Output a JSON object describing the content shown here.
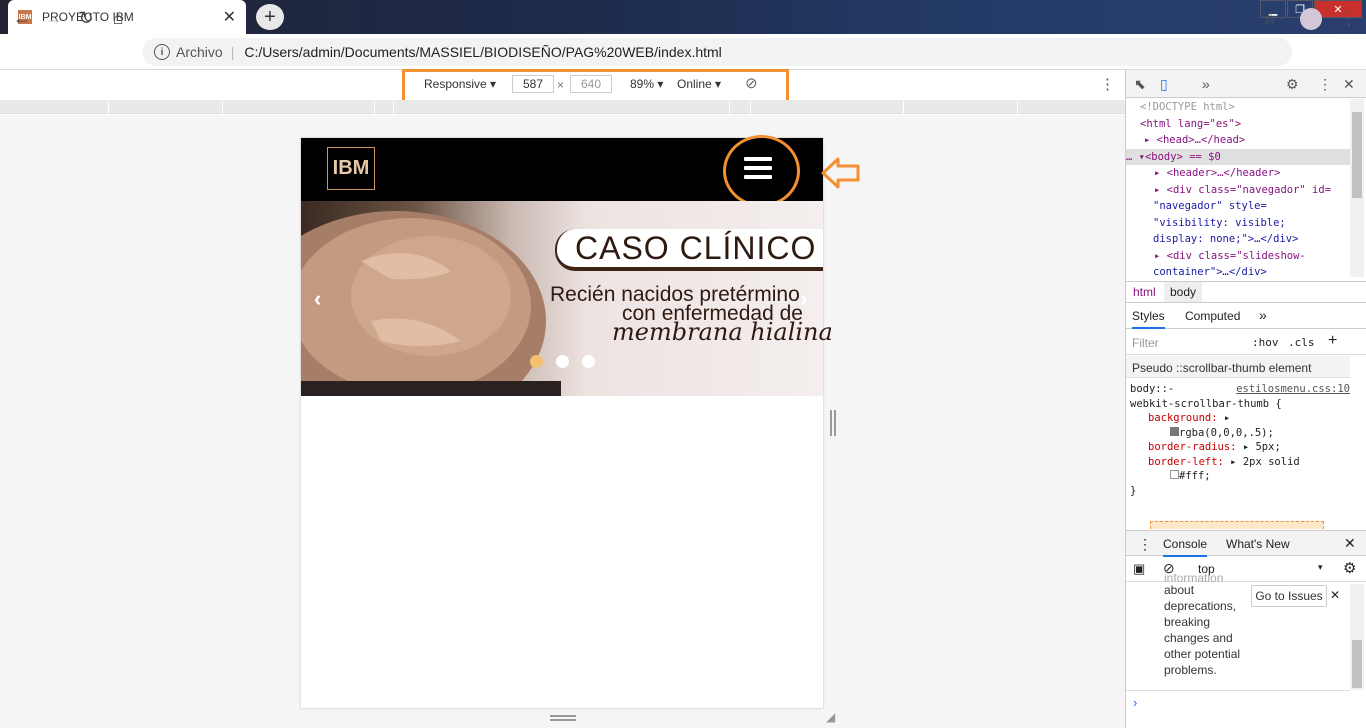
{
  "browser": {
    "tab_title": "PROYECTO IBM",
    "tab_favicon": "IBM",
    "tab_close": "✕",
    "new_tab": "+",
    "site_label": "Archivo",
    "url": "C:/Users/admin/Documents/MASSIEL/BIODISEÑO/PAG%20WEB/index.html"
  },
  "device_toolbar": {
    "mode": "Responsive",
    "width": "587",
    "height": "640",
    "zoom": "89%",
    "network": "Online",
    "times": "×"
  },
  "site": {
    "logo": "IBM",
    "slide_title": "CASO CLÍNICO",
    "slide_line1": "Recién nacidos pretérmino",
    "slide_line2": "con enfermedad de",
    "slide_line3": "membrana hialina",
    "prev": "‹",
    "next": "›",
    "dots_active_color": "#f5c071",
    "dots_color": "#ffffff"
  },
  "devtools": {
    "dom": {
      "doctype": "<!DOCTYPE html>",
      "html_open": "<html lang=\"es\">",
      "head": "<head>…</head>",
      "body": "<body> == $0",
      "header": "<header>…</header>",
      "div_nav": "<div class=\"navegador\" id=",
      "div_nav2": "\"navegador\" style=",
      "div_nav3": "\"visibility: visible;",
      "div_nav4": "display: none;\">…</div>",
      "div_slide": "<div class=\"slideshow-",
      "div_slide2": "container\">…</div>"
    },
    "crumbs": [
      "html",
      "body"
    ],
    "styles_tabs": [
      "Styles",
      "Computed"
    ],
    "filter_placeholder": "Filter",
    "hov": ":hov",
    "cls": ".cls",
    "pseudo": "Pseudo ::scrollbar-thumb element",
    "rule_selector": "body::-webkit-scrollbar-thumb {",
    "rule_selector_a": "body::-",
    "rule_selector_b": "webkit-scrollbar-thumb {",
    "rule_source": "estilosmenu.css:10",
    "rule_props": [
      {
        "name": "background:",
        "value": "rgba(0,0,0,.5);"
      },
      {
        "name": "border-radius:",
        "value": "5px;"
      },
      {
        "name": "border-left:",
        "value": "2px solid"
      }
    ],
    "fff": "#fff;",
    "close_brace": "}",
    "console_tabs": [
      "Console",
      "What's New"
    ],
    "context": "top",
    "console_message": [
      "information",
      "about",
      "deprecations,",
      "breaking",
      "changes and",
      "other potential",
      "problems."
    ],
    "go_issues": "Go to Issues"
  },
  "colors": {
    "annotation": "#f39032"
  }
}
